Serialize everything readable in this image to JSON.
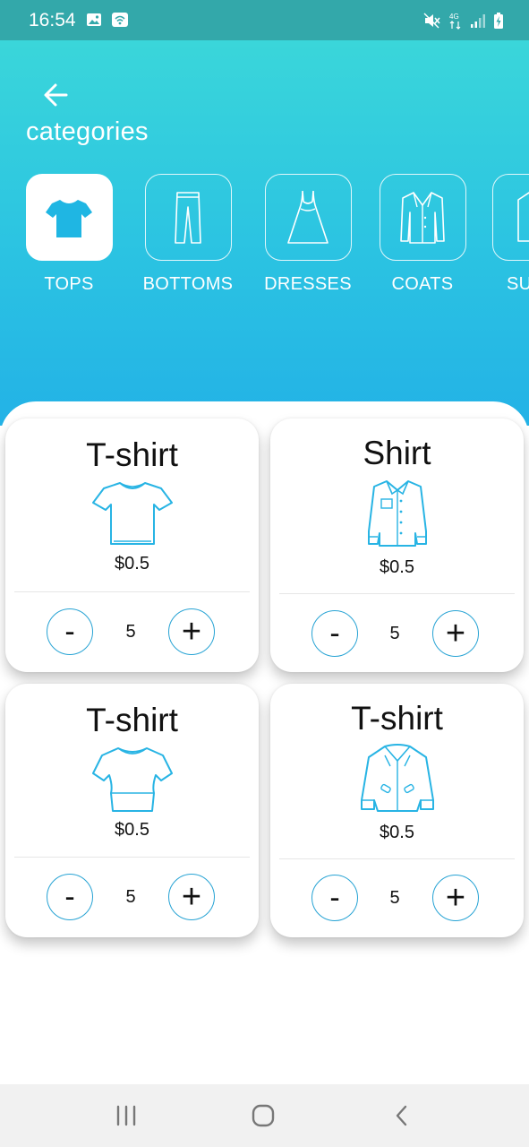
{
  "status_bar": {
    "time": "16:54",
    "left_icons": [
      "image-icon",
      "wifi-hotspot-icon"
    ],
    "right_icons": [
      "mute-icon",
      "4g-data-icon",
      "signal-icon",
      "battery-charging-icon"
    ],
    "network_label": "4G"
  },
  "header": {
    "title": "categories",
    "back_icon": "arrow-left-icon"
  },
  "categories": [
    {
      "label": "TOPS",
      "icon": "tshirt-icon",
      "active": true
    },
    {
      "label": "BOTTOMS",
      "icon": "trousers-icon",
      "active": false
    },
    {
      "label": "DRESSES",
      "icon": "dress-icon",
      "active": false
    },
    {
      "label": "COATS",
      "icon": "coat-icon",
      "active": false
    },
    {
      "label": "SU",
      "icon": "suit-icon",
      "active": false
    }
  ],
  "products": [
    {
      "title": "T-shirt",
      "icon": "tshirt-icon",
      "price": "$0.5",
      "quantity": "5",
      "minus": "-",
      "plus": "+"
    },
    {
      "title": "Shirt",
      "icon": "shirt-icon",
      "price": "$0.5",
      "quantity": "5",
      "minus": "-",
      "plus": "+"
    },
    {
      "title": "T-shirt",
      "icon": "blouse-icon",
      "price": "$0.5",
      "quantity": "5",
      "minus": "-",
      "plus": "+"
    },
    {
      "title": "T-shirt",
      "icon": "jacket-icon",
      "price": "$0.5",
      "quantity": "5",
      "minus": "-",
      "plus": "+"
    }
  ],
  "nav_bar": {
    "items": [
      "recent-apps-icon",
      "home-icon",
      "back-icon"
    ]
  },
  "colors": {
    "status_bar": "#33a8aa",
    "header_top": "#3ad6da",
    "header_bottom": "#23b2e6",
    "accent": "#27a3d4",
    "icon_blue": "#28b4e4",
    "nav_bar": "#f1f1f1"
  }
}
